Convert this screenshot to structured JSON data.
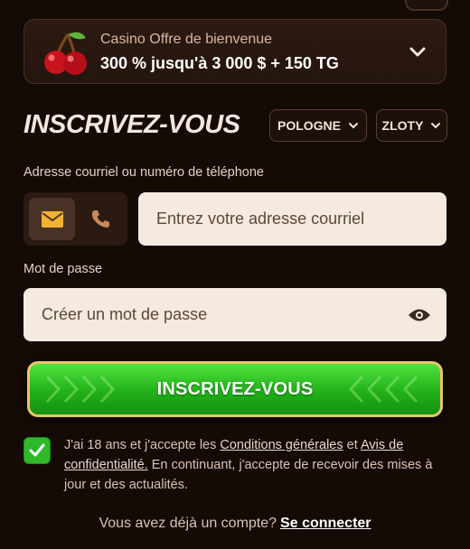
{
  "bonus": {
    "title": "Casino Offre de bienvenue",
    "amount": "300 % jusqu'à 3 000 $ + 150 TG",
    "icon": "cherry-icon",
    "toggle_icon": "chevron-down-icon"
  },
  "signup": {
    "heading": "INSCRIVEZ-VOUS",
    "country": "POLOGNE",
    "currency": "ZLOTY"
  },
  "contact": {
    "label": "Adresse courriel ou numéro de téléphone",
    "email_icon": "envelope-icon",
    "phone_icon": "phone-icon",
    "email_placeholder": "Entrez votre adresse courriel"
  },
  "password": {
    "label": "Mot de passe",
    "placeholder": "Créer un mot de passe",
    "toggle_icon": "eye-icon"
  },
  "submit": {
    "label": "INSCRIVEZ-VOUS"
  },
  "consent": {
    "checked": true,
    "text_1": "J'ai 18 ans et j'accepte les ",
    "terms_link": "Conditions générales",
    "text_2": " et ",
    "privacy_link": "Avis de confidentialité.",
    "text_3": " En continuant, j'accepte de recevoir des mises à jour et des actualités."
  },
  "login": {
    "prompt": "Vous avez déjà un compte?",
    "link": "Se connecter"
  },
  "colors": {
    "background": "#140a06",
    "accent_green": "#2fb82a",
    "accent_gold": "#e6c76a",
    "email_icon": "#f2b233",
    "phone_icon": "#c68a5a"
  }
}
